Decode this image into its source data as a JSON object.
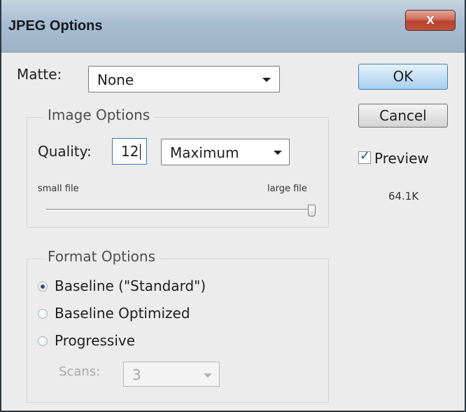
{
  "window": {
    "title": "JPEG Options",
    "close_glyph": "x"
  },
  "matte": {
    "label": "Matte:",
    "value": "None"
  },
  "buttons": {
    "ok": "OK",
    "cancel": "Cancel"
  },
  "preview": {
    "label": "Preview",
    "checked": true,
    "file_size": "64.1K"
  },
  "image_options": {
    "legend": "Image Options",
    "quality_label": "Quality:",
    "quality_value": "12",
    "quality_preset": "Maximum",
    "slider_min_label": "small file",
    "slider_max_label": "large file",
    "slider_level_fraction": 1.0
  },
  "format_options": {
    "legend": "Format Options",
    "options": [
      {
        "label": "Baseline (\"Standard\")",
        "selected": true
      },
      {
        "label": "Baseline Optimized",
        "selected": false
      },
      {
        "label": "Progressive",
        "selected": false
      }
    ],
    "scans_label": "Scans:",
    "scans_value": "3",
    "scans_enabled": false
  },
  "colors": {
    "title_bar": "#a9bdd0",
    "ok_button": "#c6e0f4",
    "close_button": "#c4533c",
    "selected_radio": "#2b4f7a"
  }
}
